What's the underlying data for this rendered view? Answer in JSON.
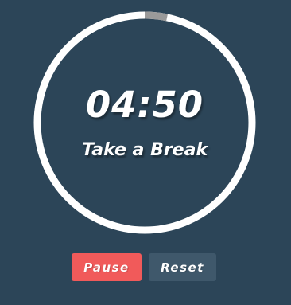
{
  "timer": {
    "time": "04:50",
    "status": "Take a Break",
    "progress_fraction": 0.0333
  },
  "controls": {
    "pause_label": "Pause",
    "reset_label": "Reset"
  },
  "colors": {
    "background": "#2c4558",
    "ring": "#ffffff",
    "ring_elapsed": "#9a9a9a",
    "pause_button": "#f15a5a",
    "reset_button": "#3f586b"
  }
}
